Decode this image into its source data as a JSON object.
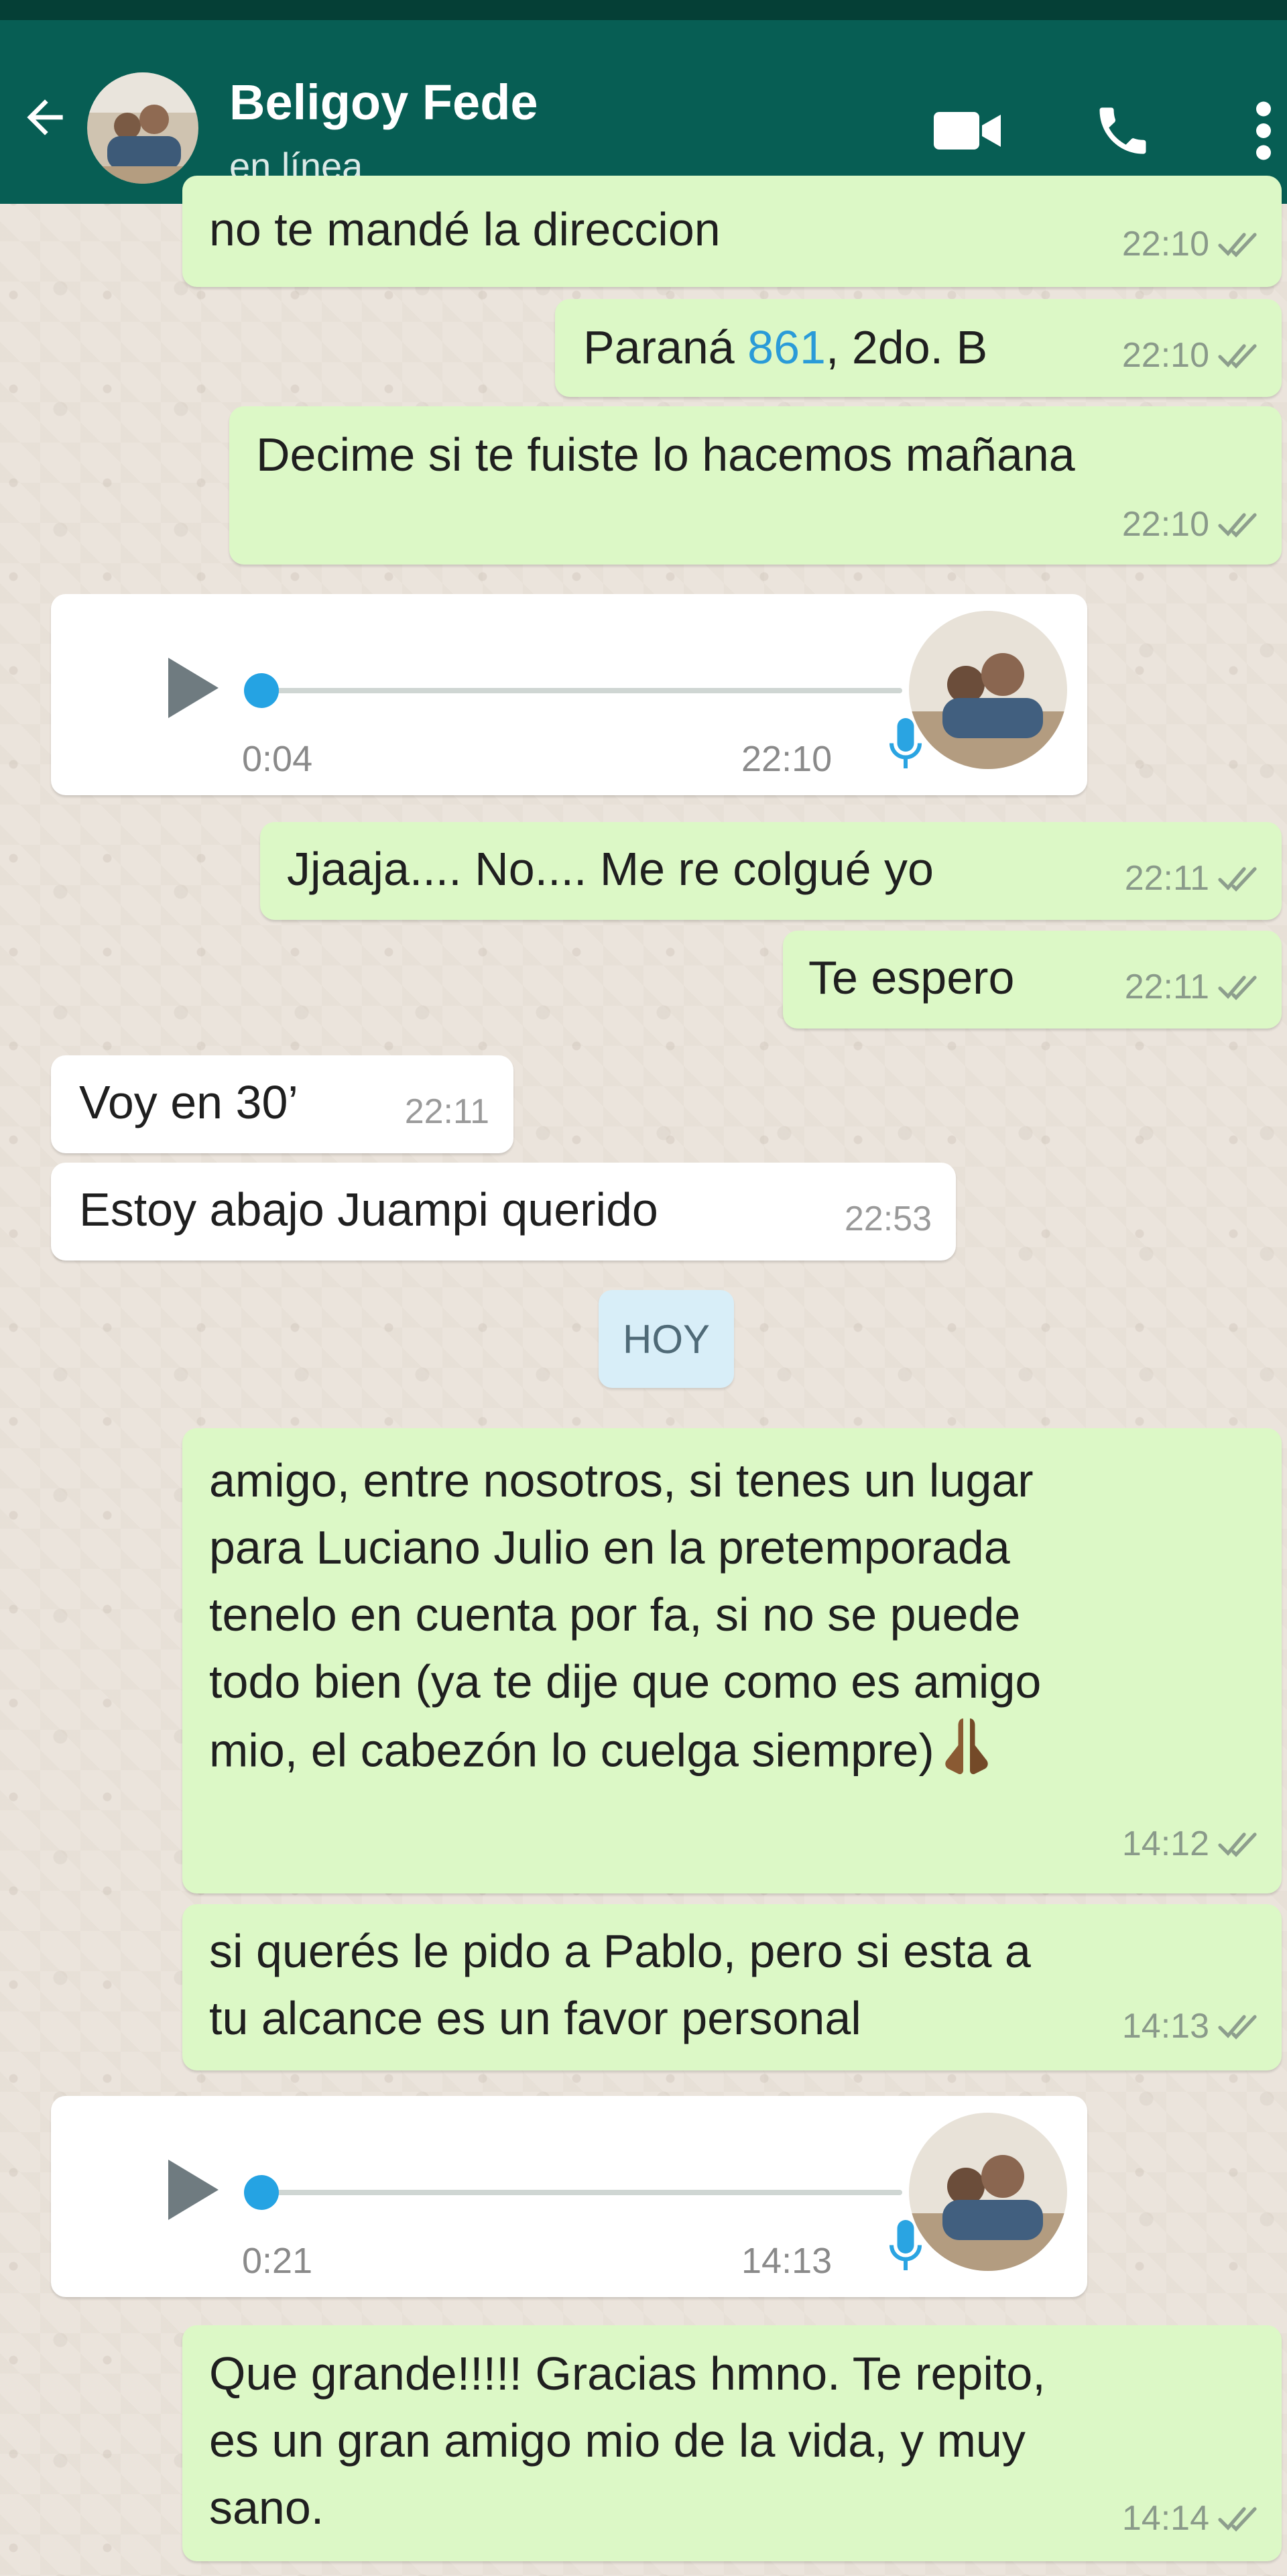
{
  "header": {
    "contact_name": "Beligoy Fede",
    "status": "en línea"
  },
  "messages": [
    {
      "direction": "out",
      "lines": [
        "no te mandé la direccion"
      ],
      "time": "22:10",
      "read": true
    },
    {
      "direction": "out",
      "text_before_link": "Paraná ",
      "link": "861",
      "text_after_link": ", 2do. B",
      "time": "22:10",
      "read": true
    },
    {
      "direction": "out",
      "lines": [
        "Decime si te fuiste lo hacemos mañana"
      ],
      "time": "22:10",
      "read": true
    },
    {
      "direction": "in",
      "type": "audio",
      "duration": "0:04",
      "time": "22:10",
      "progress": 0
    },
    {
      "direction": "out",
      "lines": [
        "Jjaaja.... No.... Me re colgué yo"
      ],
      "time": "22:11",
      "read": true
    },
    {
      "direction": "out",
      "lines": [
        "Te espero"
      ],
      "time": "22:11",
      "read": true
    },
    {
      "direction": "in",
      "lines": [
        "Voy en 30’"
      ],
      "time": "22:11"
    },
    {
      "direction": "in",
      "lines": [
        "Estoy abajo Juampi querido"
      ],
      "time": "22:53"
    },
    {
      "direction": "out",
      "lines": [
        "amigo, entre nosotros, si tenes un lugar",
        "para Luciano Julio en la pretemporada",
        "tenelo en cuenta por fa, si no se puede",
        "todo bien (ya te dije que como es amigo",
        "mio, el cabezón lo cuelga siempre)"
      ],
      "emoji": "folded-hands",
      "time": "14:12",
      "read": true
    },
    {
      "direction": "out",
      "lines": [
        "si querés le pido a Pablo, pero si esta a",
        "tu alcance es un favor personal"
      ],
      "time": "14:13",
      "read": true
    },
    {
      "direction": "in",
      "type": "audio",
      "duration": "0:21",
      "time": "14:13",
      "progress": 0
    },
    {
      "direction": "out",
      "lines": [
        "Que grande!!!!! Gracias hmno. Te repito,",
        "es un gran amigo mio de la vida, y muy",
        "sano."
      ],
      "time": "14:14",
      "read": true
    }
  ],
  "date_separator": "HOY",
  "colors": {
    "header_bg": "#075e54",
    "outgoing_bubble": "#dcf8c6",
    "incoming_bubble": "#ffffff",
    "audio_progress": "#25a3e3",
    "link": "#2a9bd8",
    "date_chip": "#d8eef8"
  },
  "icons": {
    "back": "arrow-left-icon",
    "video": "video-camera-icon",
    "call": "phone-icon",
    "more": "more-vertical-icon",
    "read_receipt": "double-check-icon",
    "play": "play-icon",
    "mic": "microphone-icon"
  }
}
